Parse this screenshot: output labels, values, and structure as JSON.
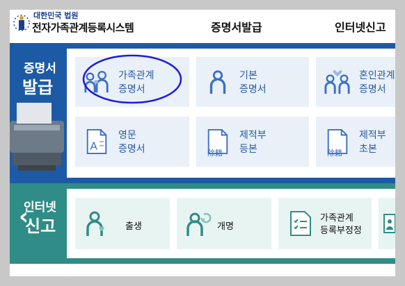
{
  "header": {
    "court_name": "대한민국 법원",
    "system_name": "전자가족관계등록시스템",
    "nav_issue": "증명서발급",
    "nav_report": "인터넷신고"
  },
  "certificate": {
    "label_line1": "증명서",
    "label_line2": "발급",
    "cards": [
      {
        "line1": "가족관계",
        "line2": "증명서"
      },
      {
        "line1": "기본",
        "line2": "증명서"
      },
      {
        "line1": "혼인관계",
        "line2": "증명서"
      },
      {
        "line1": "영문",
        "line2": "증명서"
      },
      {
        "line1": "제적부",
        "line2": "등본"
      },
      {
        "line1": "제적부",
        "line2": "초본"
      }
    ],
    "remove_label": "除籍"
  },
  "report": {
    "label_line1": "인터넷",
    "label_line2": "신고",
    "cards": [
      {
        "line1": "출생",
        "line2": ""
      },
      {
        "line1": "개명",
        "line2": ""
      },
      {
        "line1": "가족관계",
        "line2": "등록부정정"
      }
    ]
  },
  "colors": {
    "certificate_band": "#1d5aa6",
    "report_band": "#2f8c86",
    "highlight_circle": "#1a1adf"
  }
}
